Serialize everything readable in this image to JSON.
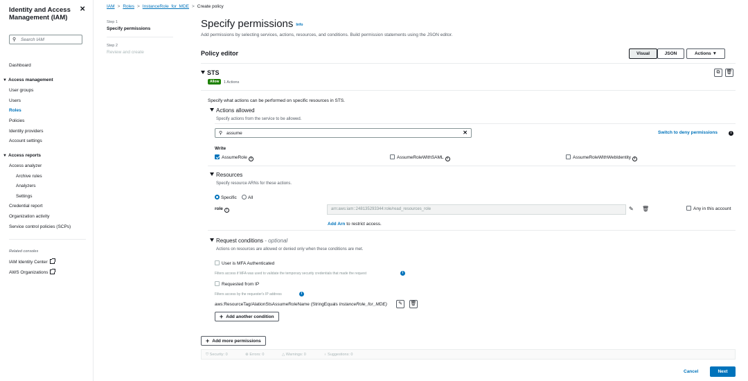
{
  "sidebar": {
    "title": "Identity and Access Management (IAM)",
    "close": "✕",
    "search_placeholder": "Search IAM",
    "dashboard": "Dashboard",
    "access_management": "Access management",
    "am_items": [
      "User groups",
      "Users",
      "Roles",
      "Policies",
      "Identity providers",
      "Account settings"
    ],
    "access_reports": "Access reports",
    "ar_items": [
      "Access analyzer",
      "Archive rules",
      "Analyzers",
      "Settings",
      "Credential report",
      "Organization activity",
      "Service control policies (SCPs)"
    ],
    "related_consoles": "Related consoles",
    "related": [
      "IAM Identity Center",
      "AWS Organizations"
    ]
  },
  "breadcrumb": [
    "IAM",
    "Roles",
    "InstanceRole_for_MDE",
    "Create policy"
  ],
  "steps": [
    {
      "label": "Step 1",
      "text": "Specify permissions"
    },
    {
      "label": "Step 2",
      "text": "Review and create"
    }
  ],
  "page": {
    "title": "Specify permissions",
    "info": "Info",
    "description": "Add permissions by selecting services, actions, resources, and conditions. Build permission statements using the JSON editor.",
    "editor_title": "Policy editor",
    "tabs": [
      "Visual",
      "JSON"
    ],
    "actions_btn": "Actions"
  },
  "service": {
    "name": "STS",
    "effect": "Allow",
    "count": "1 Actions",
    "intro": "Specify what actions can be performed on specific resources in STS.",
    "actions_allowed": "Actions allowed",
    "actions_desc": "Specify actions from the service to be allowed.",
    "search_value": "assume",
    "switch_deny": "Switch to deny permissions",
    "write": "Write",
    "actions": [
      {
        "name": "AssumeRole",
        "checked": true
      },
      {
        "name": "AssumeRoleWithSAML",
        "checked": false
      },
      {
        "name": "AssumeRoleWithWebIdentity",
        "checked": false
      }
    ]
  },
  "resources": {
    "title": "Resources",
    "desc": "Specify resource ARNs for these actions.",
    "specific": "Specific",
    "all": "All",
    "role_label": "role",
    "arn_value": "arn:aws:iam::248135293344:role/read_resources_role",
    "any_in_account": "Any in this account",
    "add_arn": "Add Arn",
    "add_arn_suffix": "to restrict access."
  },
  "conditions": {
    "title": "Request conditions",
    "optional": "- optional",
    "desc": "Actions on resources are allowed or denied only when these conditions are met.",
    "mfa": "User is MFA Authenticated",
    "mfa_desc": "Filters access if MFA was used to validate the temporary security credentials that made the request",
    "ip": "Requested from IP",
    "ip_desc": "Filters access by the requester's IP address",
    "tag_cond_key": "aws:ResourceTag/AlationStsAssumeRoleName (StringEquals",
    "tag_cond_val": "InstanceRole_for_MDE)",
    "add_condition": "Add another condition"
  },
  "add_more": "Add more permissions",
  "validation": [
    "Security: 0",
    "Errors: 0",
    "Warnings: 0",
    "Suggestions: 0"
  ],
  "footer": {
    "cancel": "Cancel",
    "next": "Next"
  }
}
